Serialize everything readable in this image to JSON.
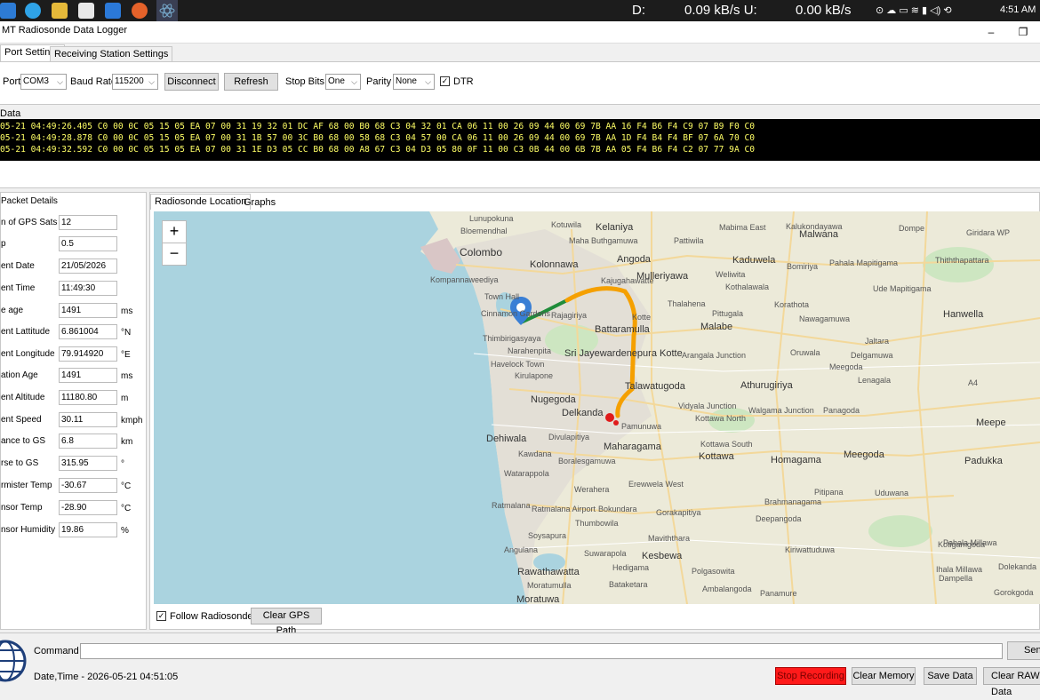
{
  "taskbar": {
    "drive_label": "D:",
    "download_speed": "0.09 kB/s U:",
    "upload_speed": "0.00 kB/s",
    "clock": "4:51 AM"
  },
  "window": {
    "title": "MT Radiosonde Data Logger",
    "minimize_glyph": "–",
    "maximize_glyph": "❐"
  },
  "tabs": [
    {
      "label": "Port Settings"
    },
    {
      "label": "Receiving Station Settings"
    }
  ],
  "port_settings": {
    "port_label": "Port",
    "port_value": "COM3",
    "baud_label": "Baud Rate",
    "baud_value": "115200",
    "disconnect_label": "Disconnect",
    "refresh_label": "Refresh",
    "stopbits_label": "Stop Bits",
    "stopbits_value": "One",
    "parity_label": "Parity",
    "parity_value": "None",
    "dtr_label": "DTR",
    "dtr_checked": true
  },
  "data_section": {
    "title": "Data",
    "lines": [
      "05-21 04:49:26.405 C0 00 0C 05 15 05 EA 07 00 31 19 32 01 DC AF 68 00 B0 68 C3 04 32 01 CA 06 11 00 26 09 44 00 69 7B AA 16 F4 B6 F4 C9 07 B9 F0 C0",
      "05-21 04:49:28.878 C0 00 0C 05 15 05 EA 07 00 31 1B 57 00 3C B0 68 00 58 68 C3 04 57 00 CA 06 11 00 26 09 44 00 69 7B AA 1D F4 B4 F4 BF 07 6A 70 C0",
      "05-21 04:49:32.592 C0 00 0C 05 15 05 EA 07 00 31 1E D3 05 CC B0 68 00 A8 67 C3 04 D3 05 80 0F 11 00 C3 0B 44 00 6B 7B AA 05 F4 B6 F4 C2 07 77 9A C0"
    ]
  },
  "packet_details": {
    "title": "Packet Details",
    "fields": [
      {
        "label": "n of GPS Sats",
        "value": "12",
        "unit": ""
      },
      {
        "label": "p",
        "value": "0.5",
        "unit": ""
      },
      {
        "label": "ent Date",
        "value": "21/05/2026",
        "unit": ""
      },
      {
        "label": "ent Time",
        "value": "11:49:30",
        "unit": ""
      },
      {
        "label": "e age",
        "value": "1491",
        "unit": "ms"
      },
      {
        "label": "ent Lattitude",
        "value": "6.861004",
        "unit": "°N"
      },
      {
        "label": "ent Longitude",
        "value": "79.914920",
        "unit": "°E"
      },
      {
        "label": "ation Age",
        "value": "1491",
        "unit": "ms"
      },
      {
        "label": "ent Altitude",
        "value": "11180.80",
        "unit": "m"
      },
      {
        "label": "ent Speed",
        "value": "30.11",
        "unit": "kmph"
      },
      {
        "label": "ance to GS",
        "value": "6.8",
        "unit": "km"
      },
      {
        "label": "rse to GS",
        "value": "315.95",
        "unit": "°"
      },
      {
        "label": "rmister Temp",
        "value": "-30.67",
        "unit": "°C"
      },
      {
        "label": "nsor Temp",
        "value": "-28.90",
        "unit": "°C"
      },
      {
        "label": "nsor Humidity",
        "value": "19.86",
        "unit": "%"
      }
    ]
  },
  "map_tabs": [
    {
      "label": "Radiosonde Location"
    },
    {
      "label": "Graphs"
    }
  ],
  "map": {
    "zoom_in": "+",
    "zoom_out": "−",
    "labels": [
      "Lunupokuna",
      "Bloemendhal",
      "Kotuwila",
      "Kelaniya",
      "Maha Buthgamuwa",
      "Pattiwila",
      "Mabima East",
      "Kalukondayawa",
      "Malwana",
      "Dompe",
      "Giridara WP",
      "Colombo",
      "Kolonnawa",
      "Angoda",
      "Kaduwela",
      "Bomiriya",
      "Pahala Mapitigama",
      "Thiththapattara",
      "Kompannaweediya",
      "Kajugahawatte",
      "Mulleriyawa",
      "Weliwita",
      "Kothalawala",
      "Ude Mapitigama",
      "Town Hall",
      "Cinnamon Gardens",
      "Rajagiriya",
      "Kotte",
      "Malabe",
      "Thalahena",
      "Pittugala",
      "Korathota",
      "Nawagamuwa",
      "Hanwella",
      "Battaramulla",
      "Thimbirigasyaya",
      "Narahenpita",
      "Sri Jayewardenepura Kotte",
      "Havelock Town",
      "Arangala Junction",
      "Oruwala",
      "Kirulapone",
      "Jaltara",
      "Delgamuwa",
      "Meegoda",
      "Talawatugoda",
      "Athurugiriya",
      "Lenagala",
      "Nugegoda",
      "Delkanda",
      "Pamunuwa",
      "Vidyala Junction",
      "Kottawa North",
      "Walgama Junction",
      "Panagoda",
      "A4",
      "Dehiwala",
      "Divulapitiya",
      "Kottawa South",
      "Meepe",
      "Maharagama",
      "Kottawa",
      "Homagama",
      "Meegoda",
      "Padukka",
      "Kawdana",
      "Boralesgamuwa",
      "Watarappola",
      "Werahera",
      "Erewwela West",
      "Pitipana",
      "Uduwana",
      "Ratmalana",
      "Ratmalana Airport",
      "Bokundara",
      "Gorakapitiya",
      "Brahmanagama",
      "Deepangoda",
      "Thumbowila",
      "Soysapura",
      "Maviththara",
      "Kiriwattuduwa",
      "Angulana",
      "Suwarapola",
      "Kesbewa",
      "Rawathawatta",
      "Hedigama",
      "Polgasowita",
      "Moratumulla",
      "Bataketara",
      "Ambalangoda",
      "Moratuwa",
      "Panamure",
      "Kotigamgoda",
      "Pahala Millawa",
      "Ihala Millawa",
      "Gorokgoda",
      "Dolekanda",
      "Dampella"
    ],
    "follow_label": "Follow Radiosonde",
    "follow_checked": true,
    "clear_gps_label": "Clear GPS Path"
  },
  "bottom": {
    "command_label": "Command",
    "send_label": "Send",
    "datetime_text": "Date,Time - 2026-05-21 04:51:05",
    "stop_recording_label": "Stop Recording",
    "clear_memory_label": "Clear Memory",
    "save_data_label": "Save Data",
    "clear_raw_label": "Clear RAW Data"
  },
  "colors": {
    "stop_button": "#ff1a1a",
    "terminal_bg": "#000000",
    "terminal_text": "#ffff66",
    "flight_path_recent": "#f5a000",
    "flight_path_start": "#1f8c3a",
    "marker_pin": "#3a7fd5",
    "current_position": "#e01b1b",
    "sea": "#aad3df"
  },
  "icons": [
    "windows-start-icon",
    "edge-icon",
    "file-explorer-icon",
    "notepad-icon",
    "app-icon",
    "firefox-icon",
    "react-app-icon",
    "location-pin-icon",
    "globe-logo-icon"
  ]
}
